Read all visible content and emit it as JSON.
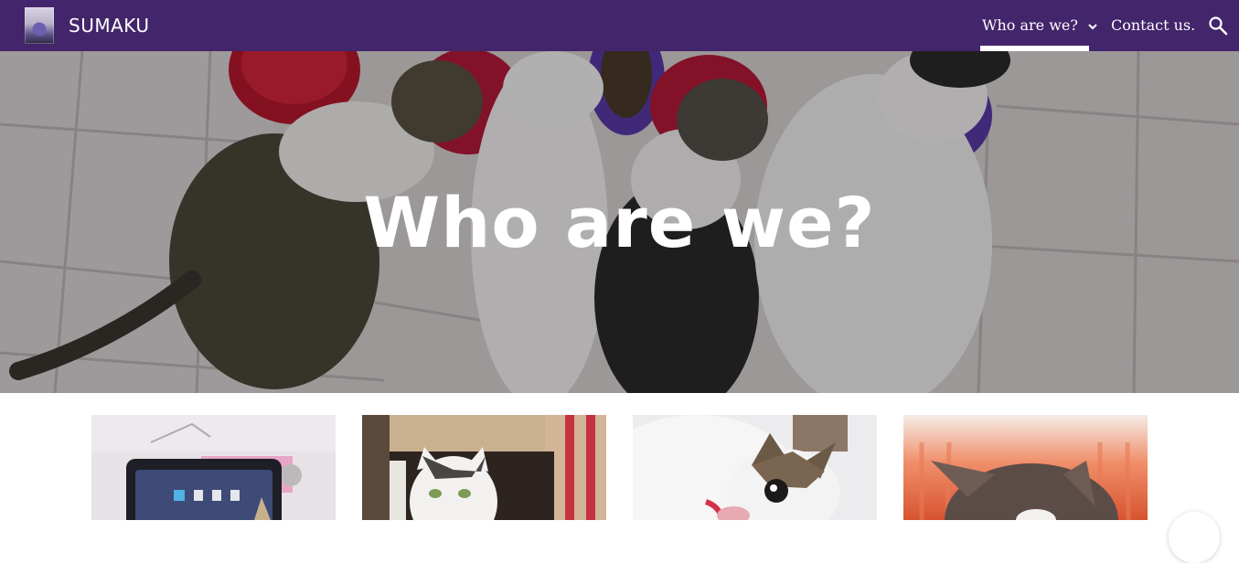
{
  "header": {
    "site_title": "SUMAKU",
    "nav": [
      {
        "label": "Who are we?",
        "active": true,
        "has_submenu": true
      },
      {
        "label": "Contact us."
      }
    ],
    "icons": {
      "logo": "site-logo",
      "dropdown": "chevron-down-icon",
      "search": "search-icon"
    },
    "colors": {
      "bar": "#43256b",
      "text": "#ffffff"
    }
  },
  "hero": {
    "title": "Who are we?"
  },
  "gallery": {
    "images": [
      {
        "name": "cat-with-tablet-photo"
      },
      {
        "name": "cat-in-box-photo"
      },
      {
        "name": "cat-lying-photo"
      },
      {
        "name": "cat-by-curtain-photo"
      }
    ]
  }
}
